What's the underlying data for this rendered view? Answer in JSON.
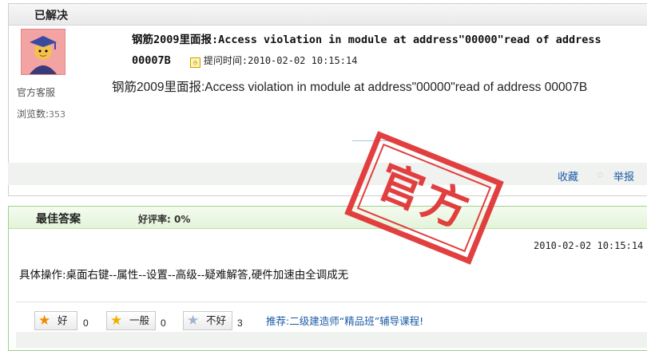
{
  "question": {
    "status_header": "已解决",
    "author": "官方客服",
    "views_label": "浏览数:",
    "views_count": "353",
    "title": "钢筋2009里面报:Access violation in module at address\"00000\"read of address 00007B",
    "time_label": "提问时间:",
    "time": "2010-02-02 10:15:14",
    "body": "钢筋2009里面报:Access violation in module at address\"00000\"read of address 00007B",
    "actions": {
      "favorite": "收藏",
      "report": "举报"
    }
  },
  "answer": {
    "header": "最佳答案",
    "rating_label": "好评率:",
    "rating_value": "0%",
    "time": "2010-02-02 10:15:14",
    "body": "具体操作:桌面右键--属性--设置--高级--疑难解答,硬件加速由全调成无",
    "votes": [
      {
        "label": "好",
        "count": "0"
      },
      {
        "label": "一般",
        "count": "0"
      },
      {
        "label": "不好",
        "count": "3"
      }
    ],
    "promo": "推荐:二级建造师“精品班”辅导课程!"
  },
  "stamp": {
    "text": "官方",
    "color": "#e03030"
  },
  "icons": [
    "avatar-image",
    "clock-icon",
    "star-outline-icon",
    "star-good-icon",
    "star-half-icon",
    "star-empty-icon"
  ]
}
